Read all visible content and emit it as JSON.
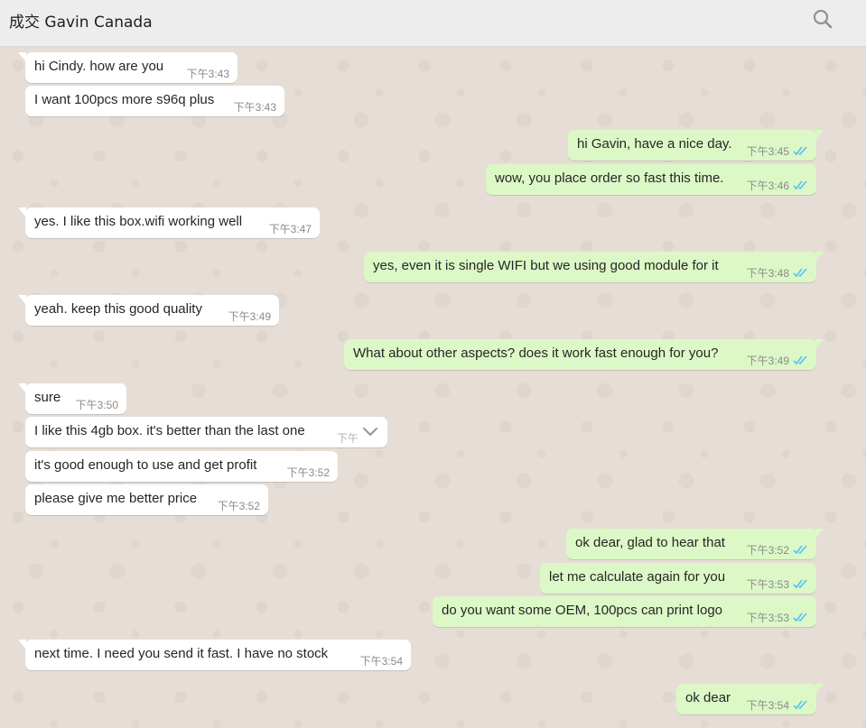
{
  "header": {
    "title": "成交 Gavin Canada",
    "search_icon": "search-icon"
  },
  "colors": {
    "incoming_bubble": "#ffffff",
    "outgoing_bubble": "#dcf8c6",
    "read_ticks": "#4fc3f7",
    "background": "#e5ddd5"
  },
  "messages": [
    {
      "dir": "in",
      "text": "hi Cindy.  how are you",
      "time": "下午3:43",
      "tail": true
    },
    {
      "dir": "in",
      "text": "I want 100pcs more s96q plus",
      "time": "下午3:43"
    },
    {
      "dir": "out",
      "text": "hi Gavin, have a nice day.",
      "time": "下午3:45",
      "tail": true,
      "status": "read"
    },
    {
      "dir": "out",
      "text": "wow, you place order so fast this time.",
      "time": "下午3:46",
      "status": "read"
    },
    {
      "dir": "in",
      "text": "yes.  I like this box.wifi working well",
      "time": "下午3:47",
      "tail": true
    },
    {
      "dir": "out",
      "text": "yes, even it is single WIFI but we using good module for it",
      "time": "下午3:48",
      "tail": true,
      "status": "read"
    },
    {
      "dir": "in",
      "text": "yeah.  keep this good quality",
      "time": "下午3:49",
      "tail": true
    },
    {
      "dir": "out",
      "text": "What about other aspects? does it work fast enough for you?",
      "time": "下午3:49",
      "tail": true,
      "status": "read"
    },
    {
      "dir": "in",
      "text": "sure",
      "time": "下午3:50",
      "tail": true
    },
    {
      "dir": "in",
      "text": "I like this 4gb box.  it's better than the last one",
      "time": "下午",
      "hovered": true,
      "menu_icon": "chevron-down-icon"
    },
    {
      "dir": "in",
      "text": "it's good enough to use and get profit",
      "time": "下午3:52"
    },
    {
      "dir": "in",
      "text": "please give me better price",
      "time": "下午3:52"
    },
    {
      "dir": "out",
      "text": "ok dear, glad to hear that",
      "time": "下午3:52",
      "tail": true,
      "status": "read"
    },
    {
      "dir": "out",
      "text": "let me calculate again for you",
      "time": "下午3:53",
      "status": "read"
    },
    {
      "dir": "out",
      "text": "do you want some OEM, 100pcs can print logo",
      "time": "下午3:53",
      "status": "read"
    },
    {
      "dir": "in",
      "text": "next time.  I need you send it fast.  I have no stock",
      "time": "下午3:54",
      "tail": true
    },
    {
      "dir": "out",
      "text": "ok dear",
      "time": "下午3:54",
      "tail": true,
      "status": "read"
    }
  ]
}
